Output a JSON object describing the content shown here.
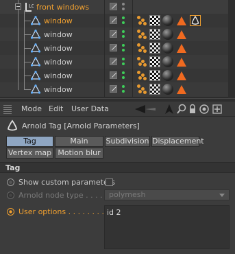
{
  "object_manager": {
    "parent": {
      "label": "front windows",
      "layer": "L0"
    },
    "children": [
      {
        "label": "window",
        "selected": true
      },
      {
        "label": "window",
        "selected": false
      },
      {
        "label": "window",
        "selected": false
      },
      {
        "label": "window",
        "selected": false
      },
      {
        "label": "window",
        "selected": false
      },
      {
        "label": "window",
        "selected": false
      }
    ]
  },
  "attribute_manager": {
    "menu": {
      "mode": "Mode",
      "edit": "Edit",
      "user_data": "User Data"
    },
    "title": "Arnold Tag [Arnold Parameters]",
    "tabs_row1": [
      "Tag",
      "Main",
      "Subdivision",
      "Displacement"
    ],
    "tabs_row2": [
      "Vertex map",
      "Motion blur"
    ],
    "active_tab": "Tag",
    "section": "Tag",
    "params": {
      "show_custom": "Show custom parameters",
      "node_type_label": "Arnold node type . . . . . .",
      "node_type_value": "polymesh",
      "user_options_label": "User options . . . . . . . . . .",
      "user_options_value": "id 2"
    }
  },
  "colors": {
    "accent_orange": "#f0a030",
    "active_tab": "#8fa6c2",
    "vis_green": "#3ecf5a"
  }
}
